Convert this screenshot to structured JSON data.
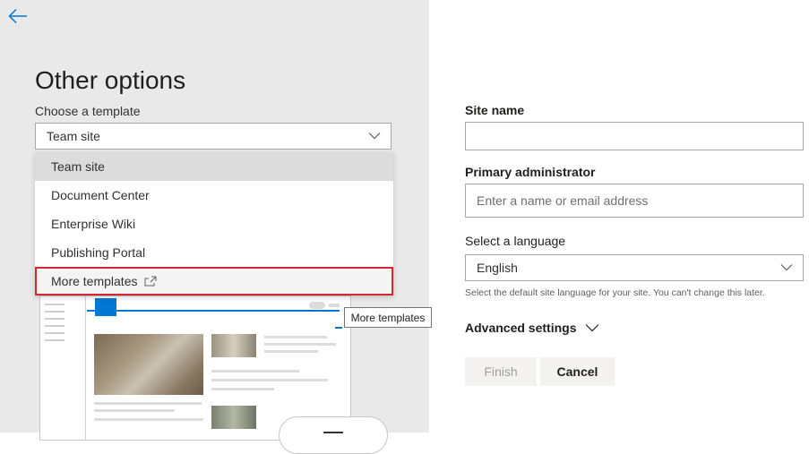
{
  "left": {
    "title": "Other options",
    "template_label": "Choose a template",
    "template_select": {
      "value": "Team site"
    },
    "dropdown_options": [
      {
        "label": "Team site",
        "state": "selected"
      },
      {
        "label": "Document Center",
        "state": "normal"
      },
      {
        "label": "Enterprise Wiki",
        "state": "normal"
      },
      {
        "label": "Publishing Portal",
        "state": "normal"
      },
      {
        "label": "More templates",
        "state": "highlighted",
        "icon": "open-in-new-window-icon"
      }
    ],
    "tooltip": "More templates"
  },
  "right": {
    "site_name": {
      "label": "Site name",
      "value": "",
      "placeholder": ""
    },
    "primary_admin": {
      "label": "Primary administrator",
      "placeholder": "Enter a name or email address"
    },
    "language": {
      "label": "Select a language",
      "value": "English",
      "help": "Select the default site language for your site. You can't change this later."
    },
    "advanced_settings": "Advanced settings",
    "buttons": {
      "finish": "Finish",
      "cancel": "Cancel"
    }
  },
  "colors": {
    "accent": "#0078d4",
    "highlight_border": "#d8262e",
    "left_pane_bg": "#e9e9e9",
    "disabled_text": "#a19f9d"
  },
  "icons": {
    "back": "arrow-left-icon",
    "dropdown": "chevron-down-icon",
    "external": "open-in-new-window-icon"
  }
}
